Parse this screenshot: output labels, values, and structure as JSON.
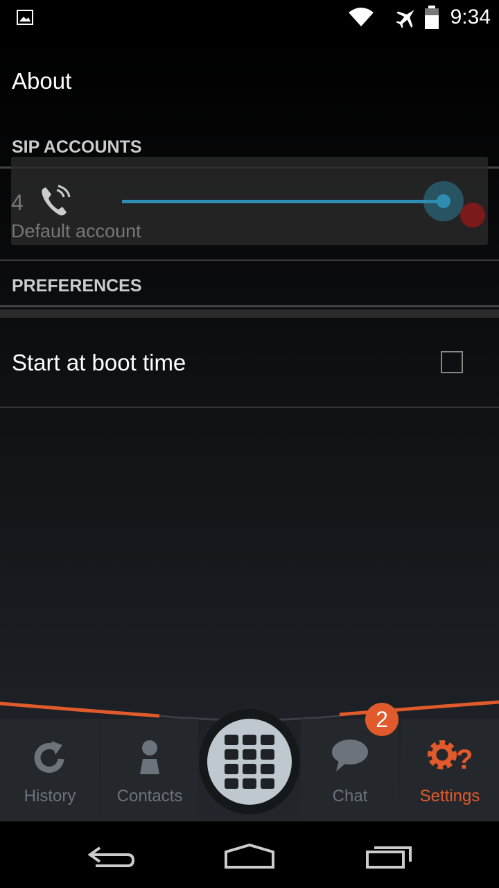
{
  "status_bar": {
    "time": "9:34",
    "icons": [
      "image-icon",
      "wifi-icon",
      "airplane-icon",
      "battery-icon"
    ]
  },
  "title": "About",
  "sip_accounts": {
    "header": "SIP ACCOUNTS",
    "account": {
      "number": "4",
      "name": "Default account",
      "enabled": true
    }
  },
  "preferences": {
    "header": "PREFERENCES",
    "start_at_boot": {
      "label": "Start at boot time",
      "checked": false
    }
  },
  "bottom_nav": {
    "tabs": [
      {
        "label": "History"
      },
      {
        "label": "Contacts"
      },
      {
        "label": "Chat",
        "badge": "2"
      },
      {
        "label": "Settings",
        "active": true
      }
    ]
  },
  "colors": {
    "accent": "#e05a2b",
    "slider": "#2e8db0"
  }
}
